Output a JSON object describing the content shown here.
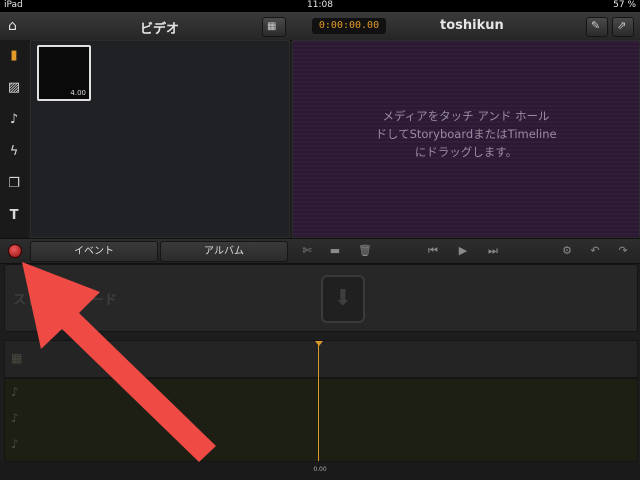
{
  "status": {
    "device": "iPad",
    "time": "11:08",
    "battery": "57 %"
  },
  "header": {
    "left_title": "ビデオ",
    "timecode": "0:00:00.00",
    "right_title": "toshikun"
  },
  "browser": {
    "clip_duration": "4.00"
  },
  "viewer": {
    "message_line1": "メディアをタッチ アンド ホール",
    "message_line2": "ドしてStoryboardまたはTimeline",
    "message_line3": "にドラッグします。"
  },
  "tabs": {
    "events": "イベント",
    "album": "アルバム"
  },
  "storyboard": {
    "label": "ストーリーボード"
  },
  "ruler": {
    "time_label": "0.00"
  },
  "colors": {
    "accent": "#e39a2a",
    "arrow": "#f04a45",
    "record": "#c41818"
  },
  "icons": [
    "home-icon",
    "grid-icon",
    "export-icon",
    "share-icon",
    "clip-icon",
    "photo-icon",
    "music-icon",
    "bolt-icon",
    "copy-icon",
    "text-icon",
    "wrench-icon",
    "film-icon",
    "trash-icon",
    "rewind-icon",
    "play-icon",
    "forward-icon",
    "gear-icon",
    "undo-icon",
    "redo-icon"
  ]
}
